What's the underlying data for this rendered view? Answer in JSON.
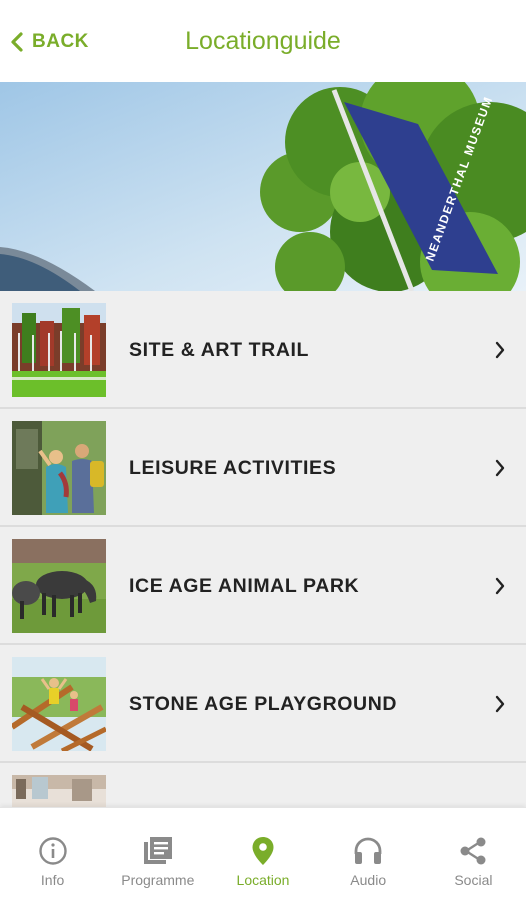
{
  "header": {
    "back_label": "BACK",
    "title": "Locationguide"
  },
  "hero": {
    "flag_text": "NEANDERTHAL MUSEUM"
  },
  "list": {
    "items": [
      {
        "label": "SITE & ART TRAIL",
        "thumb": "trail-photo"
      },
      {
        "label": "LEISURE ACTIVITIES",
        "thumb": "hikers-photo"
      },
      {
        "label": "ICE AGE ANIMAL PARK",
        "thumb": "horses-photo"
      },
      {
        "label": "STONE AGE PLAYGROUND",
        "thumb": "playground-photo"
      },
      {
        "label": "",
        "thumb": "interior-photo"
      }
    ]
  },
  "tabbar": {
    "tabs": [
      {
        "label": "Info",
        "icon": "info-icon",
        "active": false
      },
      {
        "label": "Programme",
        "icon": "programme-icon",
        "active": false
      },
      {
        "label": "Location",
        "icon": "location-pin-icon",
        "active": true
      },
      {
        "label": "Audio",
        "icon": "headphones-icon",
        "active": false
      },
      {
        "label": "Social",
        "icon": "share-icon",
        "active": false
      }
    ]
  },
  "colors": {
    "accent": "#7aad2a",
    "inactive": "#8a8a8a",
    "list_bg": "#efefef"
  }
}
